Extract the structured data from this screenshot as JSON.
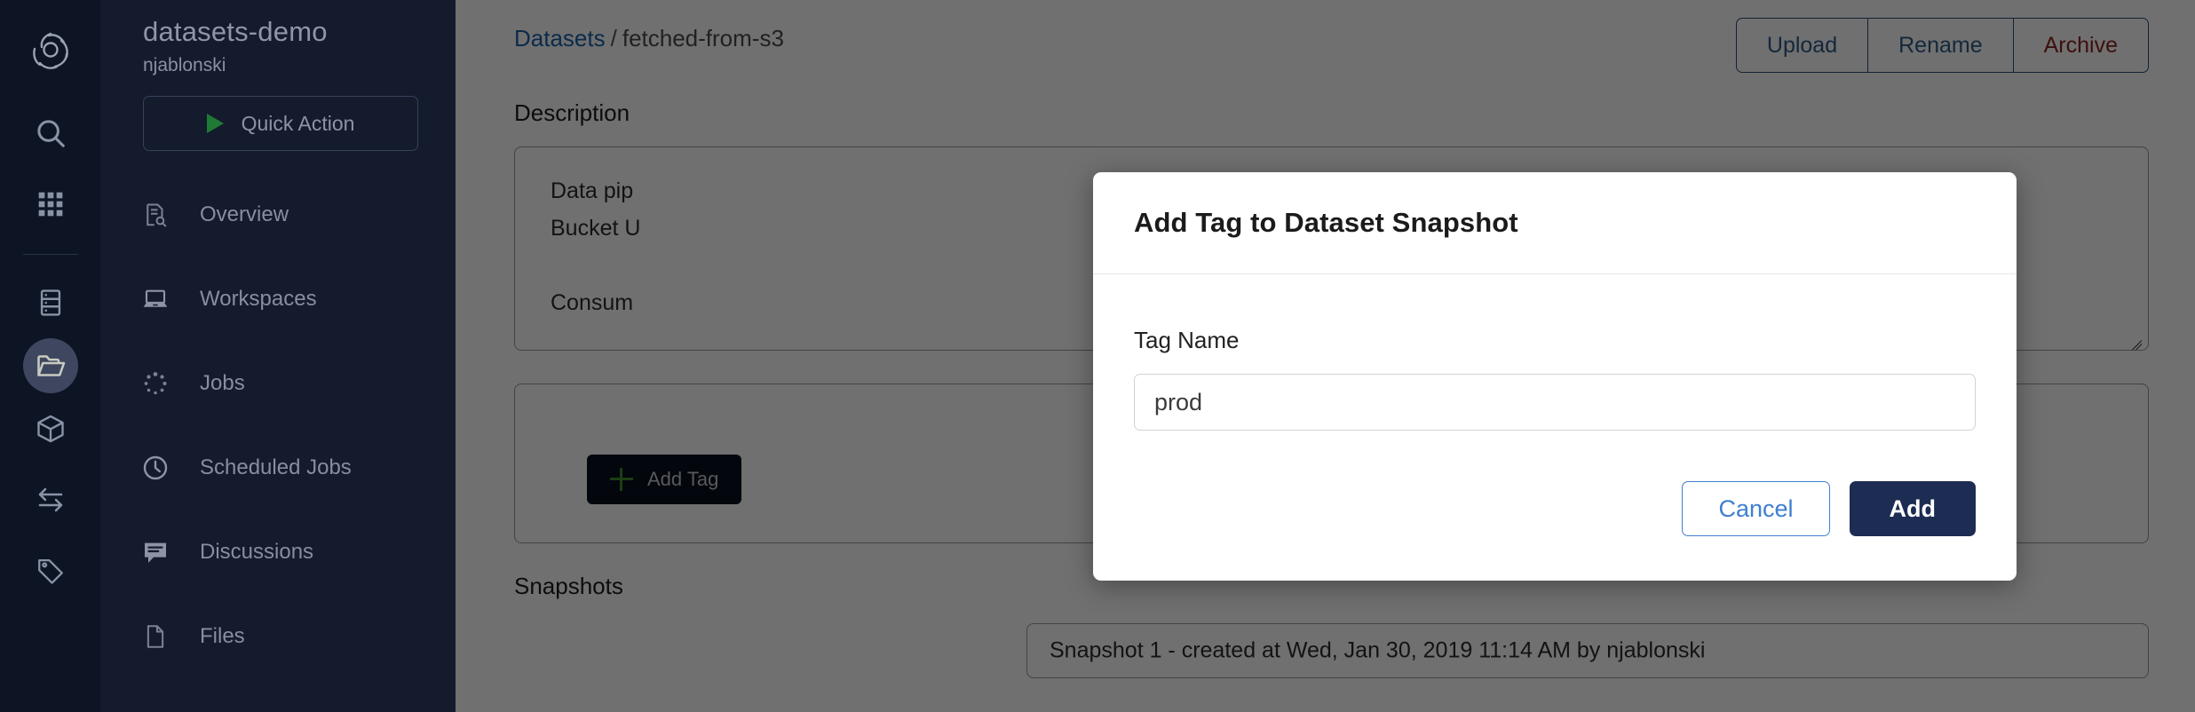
{
  "rail": {
    "icons": [
      {
        "name": "app-logo-icon",
        "label": "Logo"
      },
      {
        "name": "search-icon",
        "label": "Search"
      },
      {
        "name": "grid-apps-icon",
        "label": "Apps"
      },
      {
        "name": "data-server-icon",
        "label": "Data"
      },
      {
        "name": "folder-open-icon",
        "label": "Projects"
      },
      {
        "name": "cube-icon",
        "label": "Environments"
      },
      {
        "name": "transfer-arrows-icon",
        "label": "Transfers"
      },
      {
        "name": "tag-icon",
        "label": "Tags"
      }
    ]
  },
  "sidebar": {
    "project_name": "datasets-demo",
    "owner": "njablonski",
    "quick_action_label": "Quick Action",
    "items": [
      {
        "label": "Overview",
        "icon": "document-search-icon"
      },
      {
        "label": "Workspaces",
        "icon": "laptop-icon"
      },
      {
        "label": "Jobs",
        "icon": "spinner-dots-icon"
      },
      {
        "label": "Scheduled Jobs",
        "icon": "clock-icon"
      },
      {
        "label": "Discussions",
        "icon": "chat-bubble-icon"
      },
      {
        "label": "Files",
        "icon": "file-icon"
      }
    ]
  },
  "header": {
    "breadcrumb_root": "Datasets",
    "breadcrumb_separator": "/",
    "breadcrumb_current": "fetched-from-s3",
    "actions": [
      {
        "label": "Upload",
        "color": "#2f5b8a"
      },
      {
        "label": "Rename",
        "color": "#2f5b8a"
      },
      {
        "label": "Archive",
        "color": "#8b2620"
      }
    ]
  },
  "main": {
    "description_label": "Description",
    "description_text": "Data pip\nBucket U\n\nConsum",
    "add_tag_button_label": "Add Tag",
    "snapshots_label": "Snapshots",
    "snapshot_row": "Snapshot 1 - created at Wed, Jan 30, 2019 11:14 AM by njablonski"
  },
  "modal": {
    "title": "Add Tag to Dataset Snapshot",
    "field_label": "Tag Name",
    "field_value": "prod",
    "field_placeholder": "Tag Name",
    "cancel_label": "Cancel",
    "add_label": "Add"
  },
  "colors": {
    "rail_bg": "#0d1424",
    "sidebar_bg": "#141b2d",
    "accent_green": "#3f8f2b",
    "link_blue": "#1a63a8",
    "danger_red": "#8b2620",
    "primary_navy": "#1d2c52",
    "cancel_blue": "#3f7fd0"
  }
}
